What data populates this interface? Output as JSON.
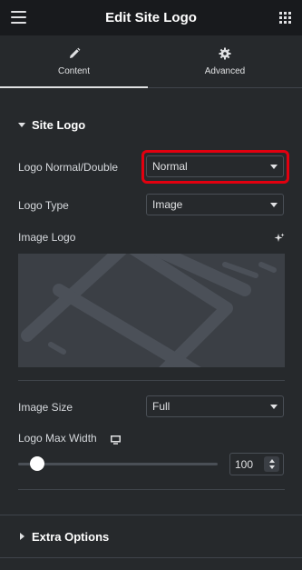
{
  "header": {
    "title": "Edit Site Logo",
    "menu_icon": "hamburger-icon",
    "apps_icon": "grid-icon"
  },
  "tabs": [
    {
      "label": "Content",
      "icon": "pencil-icon",
      "active": true
    },
    {
      "label": "Advanced",
      "icon": "gear-icon",
      "active": false
    }
  ],
  "section": {
    "title": "Site Logo",
    "logo_normal_double": {
      "label": "Logo Normal/Double",
      "value": "Normal"
    },
    "logo_type": {
      "label": "Logo Type",
      "value": "Image"
    },
    "image_logo": {
      "label": "Image Logo",
      "ai_icon": "sparkle-icon"
    },
    "image_size": {
      "label": "Image Size",
      "value": "Full"
    },
    "logo_max_width": {
      "label": "Logo Max Width",
      "value": "100",
      "device_icon": "desktop-icon"
    }
  },
  "extra_options": {
    "title": "Extra Options"
  },
  "colors": {
    "panel_bg": "#26292c",
    "header_bg": "#181a1d",
    "highlight": "#e2000f"
  }
}
